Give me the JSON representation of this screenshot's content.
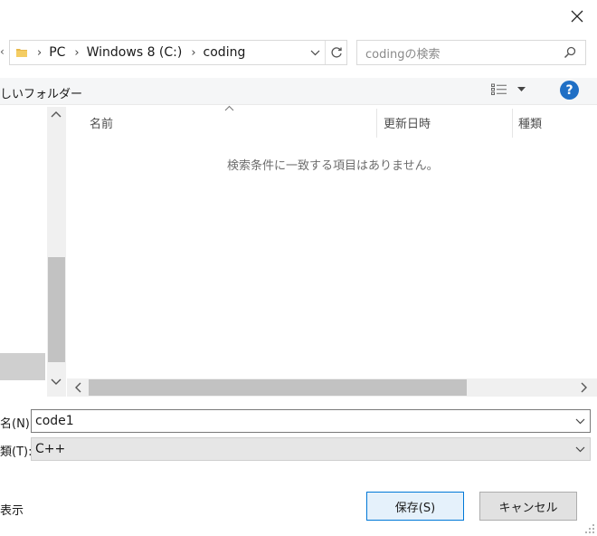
{
  "window": {
    "close_icon": "close-icon"
  },
  "address_bar": {
    "crumbs": [
      "PC",
      "Windows 8 (C:)",
      "coding"
    ]
  },
  "search": {
    "placeholder": "codingの検索"
  },
  "toolbar": {
    "new_folder_label": "しいフォルダー",
    "help_label": "?"
  },
  "file_list": {
    "columns": [
      "名前",
      "更新日時",
      "種類"
    ],
    "empty_message": "検索条件に一致する項目はありません。"
  },
  "form": {
    "filename_label": "名(N):",
    "filename_value": "code1",
    "filetype_label": "類(T):",
    "filetype_value": "C++",
    "hide_folders_label": "表示"
  },
  "buttons": {
    "save_label": "保存(S)",
    "cancel_label": "キャンセル"
  },
  "colors": {
    "accent": "#0078d7",
    "help_bg": "#1f6fc5",
    "scroll_thumb": "#c2c2c2"
  }
}
